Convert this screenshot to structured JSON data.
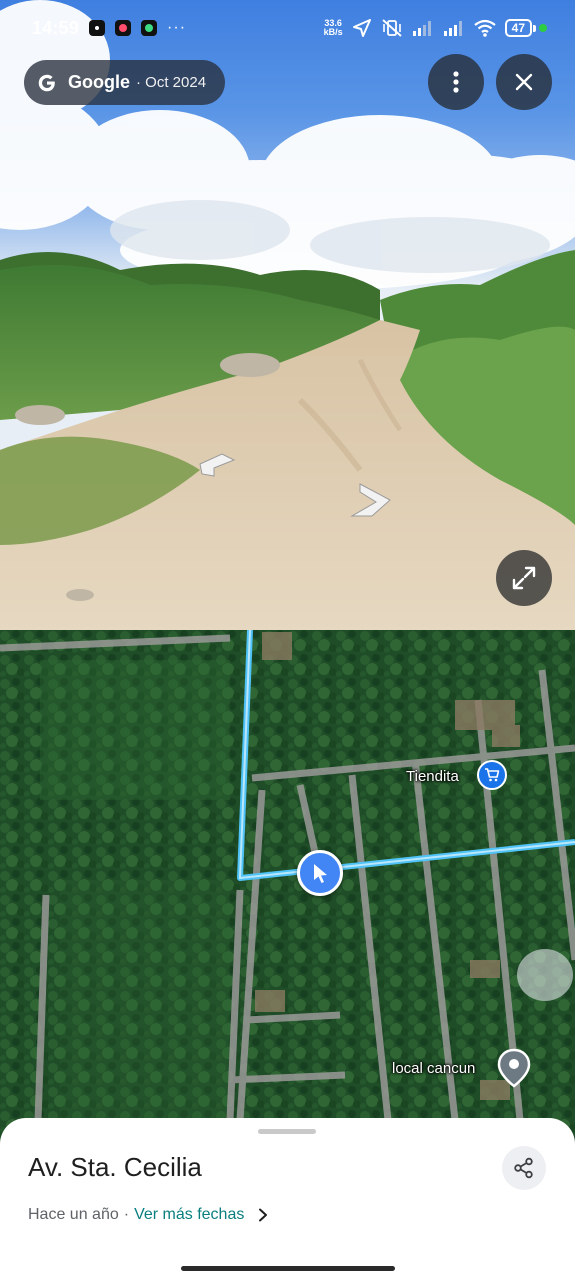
{
  "status_bar": {
    "time": "14:59",
    "more": "···",
    "network_speed_value": "33.6",
    "network_speed_unit": "kB/s",
    "battery": "47",
    "icons": [
      "notification-app-icon",
      "notification-app-icon",
      "notification-app-icon",
      "location-arrow-icon",
      "vibrate-off-icon",
      "signal-icon",
      "signal-icon",
      "wifi-icon",
      "battery-icon"
    ]
  },
  "streetview": {
    "source_name": "Google",
    "source_date": "· Oct 2024",
    "controls": [
      "more-vert-icon",
      "close-icon",
      "expand-icon"
    ]
  },
  "map": {
    "pois": [
      {
        "label": "Tiendita",
        "icon": "shopping-cart-icon"
      },
      {
        "label": "local cancun",
        "icon": "location-pin-icon"
      }
    ],
    "accent_route_color": "#4fc3f7",
    "marker_color": "#4285f4"
  },
  "sheet": {
    "title": "Av. Sta. Cecilia",
    "date_text": "Hace un año",
    "separator": "·",
    "more_dates": "Ver más fechas",
    "link_color": "#0b7f7f"
  }
}
